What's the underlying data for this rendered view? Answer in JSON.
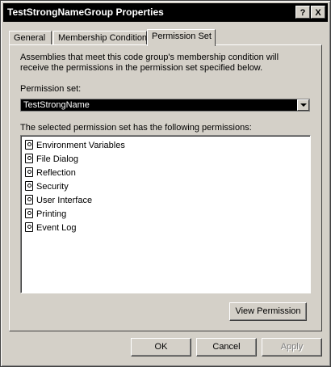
{
  "window": {
    "title": "TestStrongNameGroup Properties",
    "help_label": "?",
    "close_label": "X"
  },
  "tabs": [
    {
      "label": "General"
    },
    {
      "label": "Membership Condition"
    },
    {
      "label": "Permission Set",
      "active": true
    }
  ],
  "panel": {
    "description_line1": "Assemblies that meet this code group's membership condition will",
    "description_line2": "receive the permissions in the permission set specified below.",
    "permission_set_label": "Permission set:",
    "permission_set_value": "TestStrongName",
    "permissions_label": "The selected permission set has the following permissions:",
    "permissions": [
      "Environment Variables",
      "File Dialog",
      "Reflection",
      "Security",
      "User Interface",
      "Printing",
      "Event Log"
    ],
    "item_icon": "permission-icon",
    "view_permission_label": "View Permission"
  },
  "buttons": {
    "ok": "OK",
    "cancel": "Cancel",
    "apply": "Apply"
  }
}
